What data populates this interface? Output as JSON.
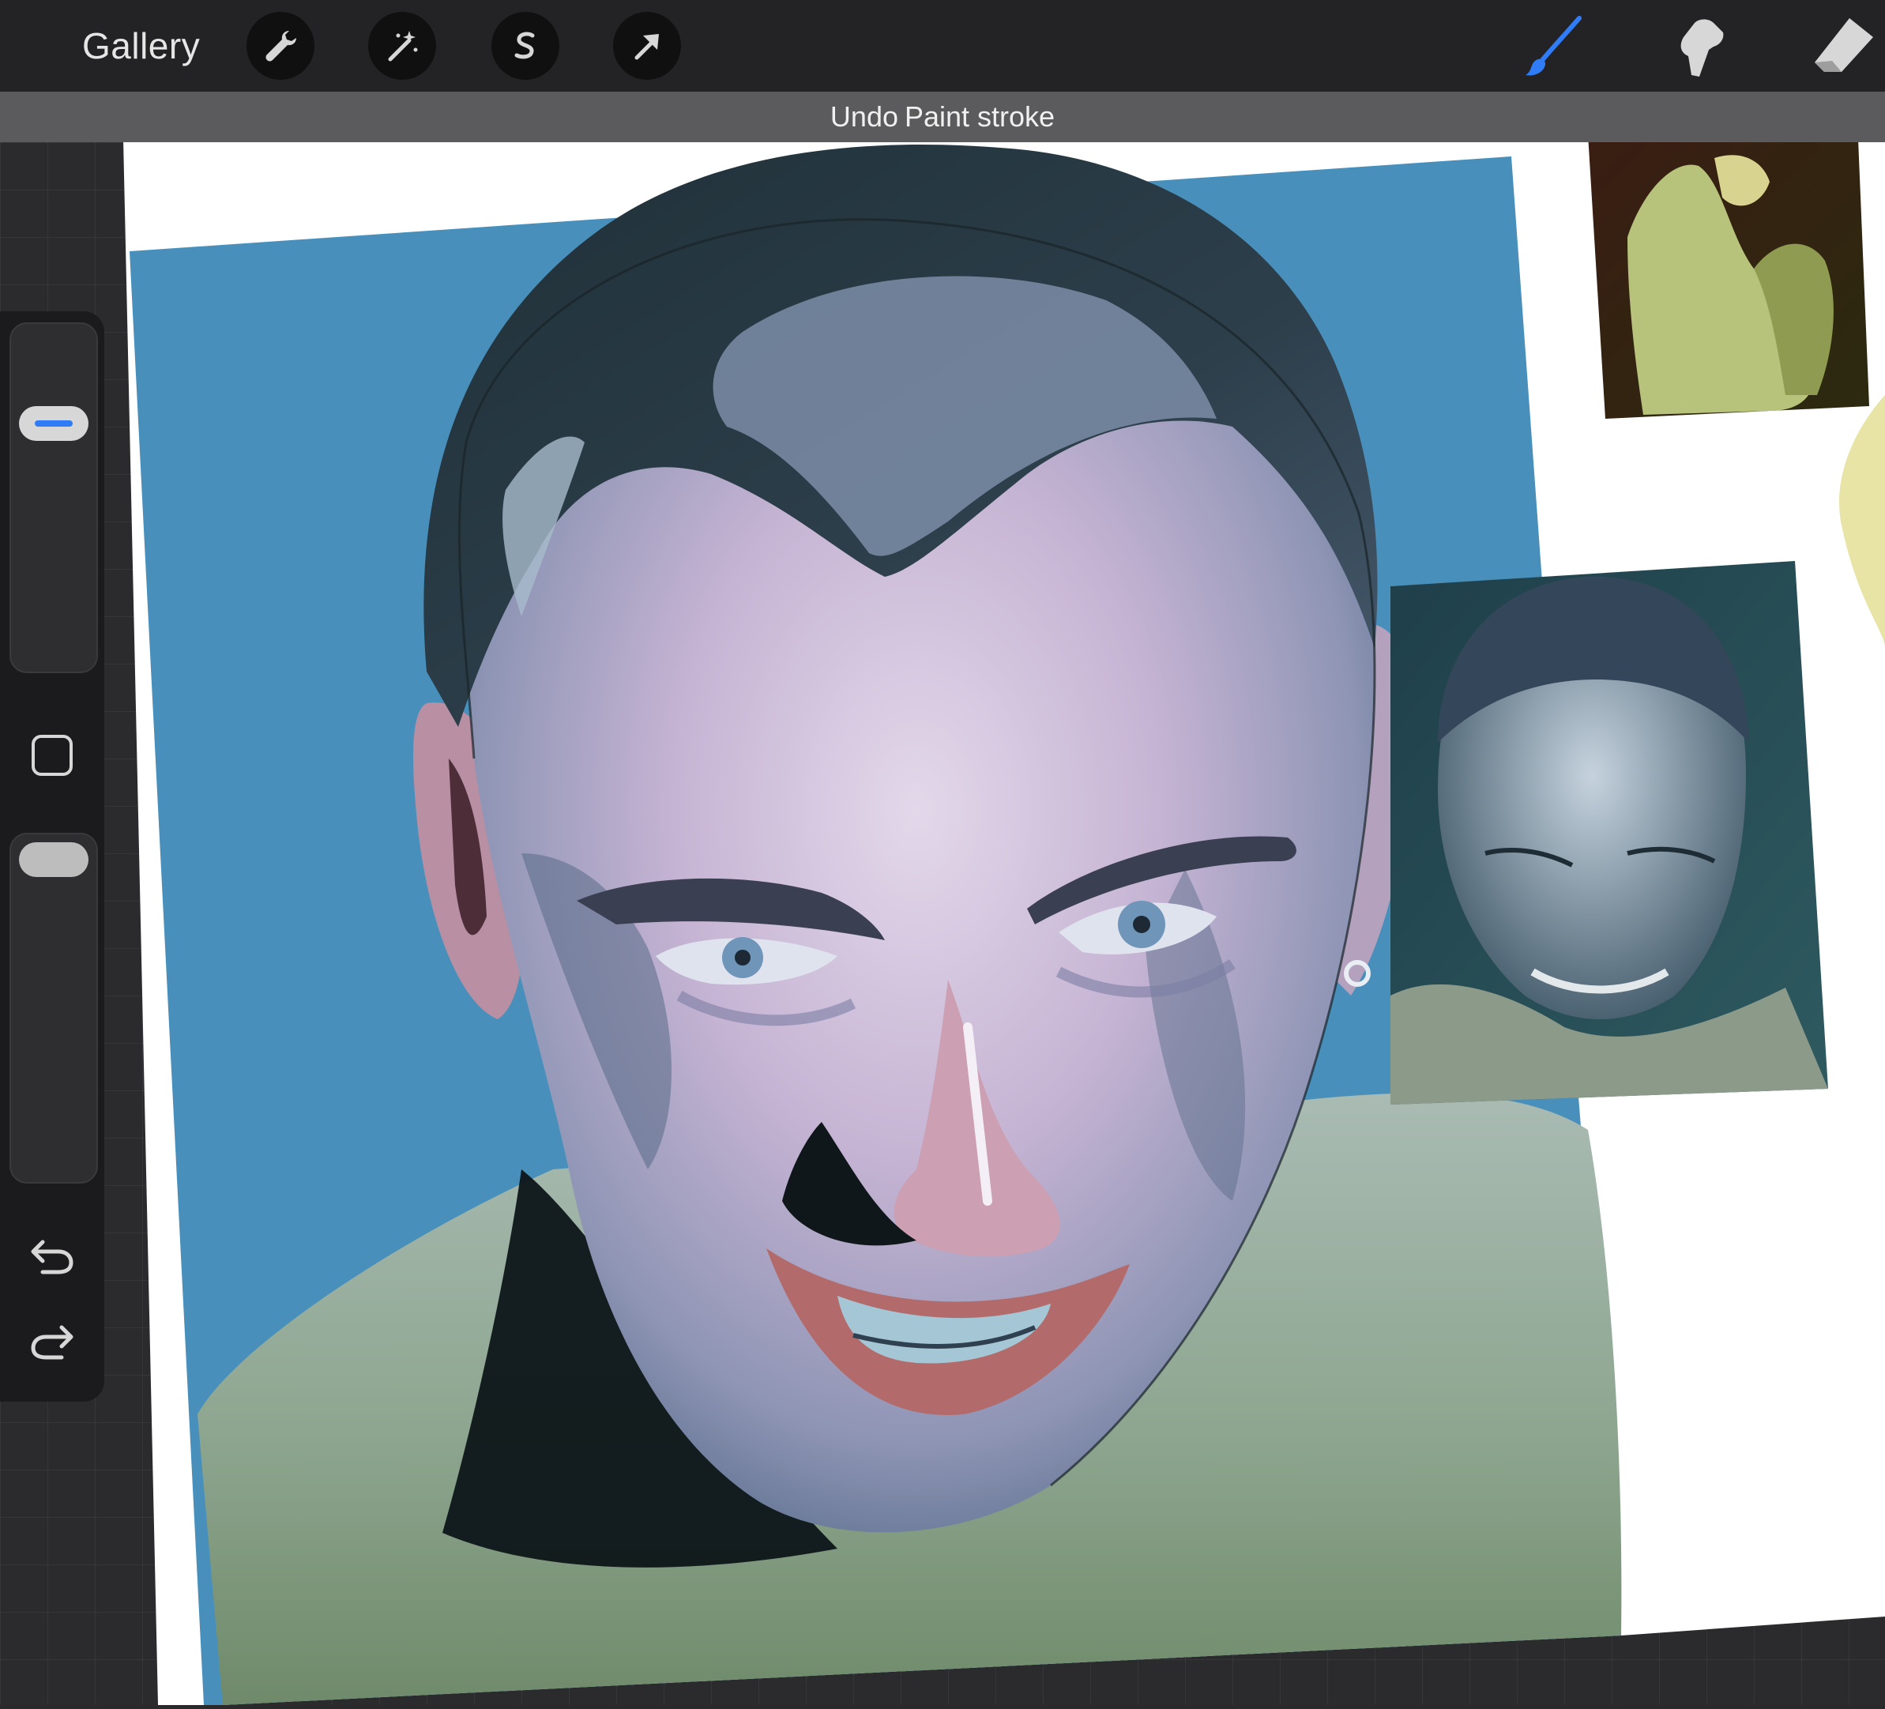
{
  "topbar": {
    "gallery_label": "Gallery",
    "left_tools": [
      "wrench-icon",
      "magic-wand-icon",
      "selection-icon",
      "transform-arrow-icon"
    ],
    "right_tools": [
      "brush-icon",
      "smudge-icon",
      "eraser-icon"
    ],
    "active_tool": "brush-icon"
  },
  "notice": {
    "action": "Undo",
    "detail": "Paint stroke"
  },
  "sidebar": {
    "brush_size_level": 0.25,
    "opacity_level": 0.0,
    "buttons": [
      "modify-square-icon",
      "undo-icon",
      "redo-icon"
    ]
  },
  "colors": {
    "accent": "#2f7cf6",
    "canvas_background": "#4890bb",
    "topbar": "#232325",
    "notice": "#5b5b5d",
    "sidebar": "#1b1b1d"
  }
}
